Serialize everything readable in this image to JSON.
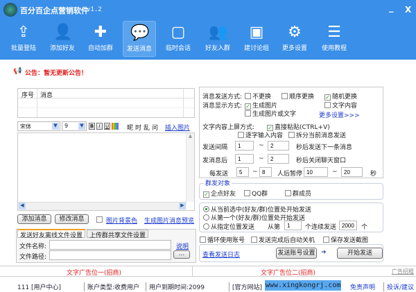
{
  "app": {
    "title": "百分百企点营销软件",
    "version": "v1.2",
    "minimize": "_",
    "close": "X"
  },
  "toolbar": [
    {
      "label": "批量登陆",
      "icon": "upload-icon"
    },
    {
      "label": "添加好友",
      "icon": "add-user-icon"
    },
    {
      "label": "自动加群",
      "icon": "add-group-icon"
    },
    {
      "label": "发送消息",
      "icon": "message-search-icon",
      "active": true
    },
    {
      "label": "临时会话",
      "icon": "chat-icon"
    },
    {
      "label": "好友入群",
      "icon": "users-icon"
    },
    {
      "label": "建讨论组",
      "icon": "presentation-icon"
    },
    {
      "label": "更多设置",
      "icon": "gears-icon"
    },
    {
      "label": "使用教程",
      "icon": "tutorial-icon"
    }
  ],
  "notice": "公告：暂无更新公告！",
  "message_table": {
    "columns": [
      "序号",
      "消息"
    ],
    "rows": []
  },
  "editor": {
    "font": "宋体",
    "size": "9",
    "bold": "B",
    "italic": "I",
    "underline": "U",
    "effects": [
      "昵",
      "时",
      "乱",
      "问"
    ],
    "insert_image": "插入图片"
  },
  "left_buttons": {
    "add": "添加消息",
    "edit": "修改消息",
    "bg_color": "图片背景色",
    "preview": "生成图片消息预览"
  },
  "file_tabs": {
    "tabs": [
      "发送好友离线文件设置",
      "上传群共享文件设置"
    ],
    "file_name_label": "文件名称:",
    "file_path_label": "文件路径:",
    "help": "说明",
    "browse": "...",
    "file_name": "",
    "file_path": ""
  },
  "settings": {
    "send_mode_label": "消息发送方式:",
    "send_modes": [
      {
        "label": "不更换",
        "checked": false
      },
      {
        "label": "顺序更换",
        "checked": false
      },
      {
        "label": "随机更换",
        "checked": true
      }
    ],
    "display_label": "消息显示方式:",
    "display": [
      {
        "label": "生成图片",
        "checked": true
      },
      {
        "label": "文字内容",
        "checked": false
      },
      {
        "label": "生成图片或文字",
        "checked": false
      }
    ],
    "more": "更多设置>>>",
    "screen_label": "文字内容上屏方式:",
    "screen": [
      {
        "label": "直接粘贴(CTRL+V)",
        "checked": true
      },
      {
        "label": "逐字输入内容",
        "checked": false
      },
      {
        "label": "拆分当前消息发送",
        "checked": false
      }
    ],
    "interval_label": "发送间隔",
    "interval_min": "1",
    "interval_max": "2",
    "interval_suffix": "秒后发送下一条消息",
    "close_label": "发消息后",
    "close_min": "1",
    "close_max": "2",
    "close_suffix": "秒后关闭聊天窗口",
    "pause_label": "每发送",
    "pause_n_min": "5",
    "pause_n_max": "8",
    "pause_mid": "人后暂停",
    "pause_s_min": "10",
    "pause_s_max": "20",
    "pause_suffix": "秒",
    "tilde": "~"
  },
  "targets": {
    "title": "群发对象",
    "items": [
      {
        "label": "企点好友",
        "checked": true
      },
      {
        "label": "QQ群",
        "checked": false
      },
      {
        "label": "群成员",
        "checked": false
      }
    ]
  },
  "start_pos": {
    "options": [
      {
        "label": "从当前选中(好友/群)位置处开始发送",
        "selected": true
      },
      {
        "label": "从第一个(好友/群)位置处开始发送",
        "selected": false
      },
      {
        "label": "从指定位置发送",
        "selected": false
      }
    ],
    "from_label": "从第",
    "from_value": "1",
    "count_label": "个连续发送",
    "count_value": "2000",
    "unit": "个"
  },
  "options": [
    {
      "label": "循环使用账号",
      "checked": false
    },
    {
      "label": "发送完成后自动关机",
      "checked": false
    },
    {
      "label": "保存发送截图",
      "checked": false
    }
  ],
  "actions": {
    "log": "查看发送日志",
    "account": "发送账号设置",
    "start": "开始发送"
  },
  "ads": {
    "ad1": "文字广告位一(招商)",
    "ad2": "文字广告位二(招商)",
    "ad_link": "广告招租"
  },
  "status": {
    "user": "111 [用户中心]",
    "account_type": "账户类型:收费用户",
    "expire": "用户到期时间:2099",
    "site_label": "[官方网站]",
    "site": "www.xingkongrj.com",
    "disclaimer": "免责声明",
    "feedback": "投诉/建议"
  },
  "colors": {
    "brand": "#3a8fe8",
    "notice": "#e02020",
    "link": "#1a3acc"
  }
}
